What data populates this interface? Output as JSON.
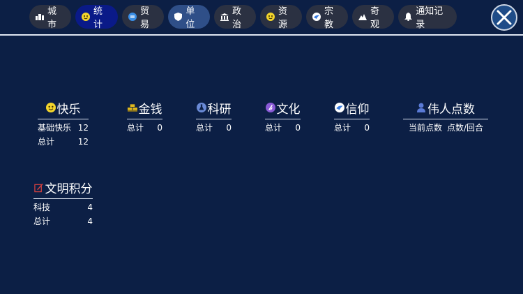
{
  "tabs": [
    {
      "label": "城市",
      "icon": "city-icon"
    },
    {
      "label": "统计",
      "icon": "happy-face-icon"
    },
    {
      "label": "贸易",
      "icon": "trade-icon"
    },
    {
      "label": "单位",
      "icon": "shield-icon"
    },
    {
      "label": "政治",
      "icon": "government-icon"
    },
    {
      "label": "资源",
      "icon": "resource-face-icon"
    },
    {
      "label": "宗教",
      "icon": "religion-dove-icon"
    },
    {
      "label": "奇观",
      "icon": "mountain-icon"
    },
    {
      "label": "通知记录",
      "icon": "bell-icon"
    }
  ],
  "close_icon": "close-x-icon",
  "stats": {
    "happiness": {
      "title": "快乐",
      "icon": "happy-face-icon",
      "rows": [
        {
          "label": "基础快乐",
          "value": "12"
        },
        {
          "label": "总计",
          "value": "12"
        }
      ]
    },
    "gold": {
      "title": "金钱",
      "icon": "gold-bars-icon",
      "rows": [
        {
          "label": "总计",
          "value": "0"
        }
      ]
    },
    "science": {
      "title": "科研",
      "icon": "science-flask-icon",
      "rows": [
        {
          "label": "总计",
          "value": "0"
        }
      ]
    },
    "culture": {
      "title": "文化",
      "icon": "culture-icon",
      "rows": [
        {
          "label": "总计",
          "value": "0"
        }
      ]
    },
    "faith": {
      "title": "信仰",
      "icon": "faith-dove-icon",
      "rows": [
        {
          "label": "总计",
          "value": "0"
        }
      ]
    },
    "great_people": {
      "title": "伟人点数",
      "icon": "person-icon",
      "headers": [
        "当前点数",
        "点数/回合"
      ]
    },
    "civ_points": {
      "title": "文明积分",
      "icon": "civ-points-icon",
      "rows": [
        {
          "label": "科技",
          "value": "4"
        },
        {
          "label": "总计",
          "value": "4"
        }
      ]
    }
  },
  "colors": {
    "background": "#0c1f45",
    "tab": "#2b3142",
    "tab_active": "#0a1a88",
    "tab_selected": "#2f4f88",
    "happy_yellow": "#f3d52c",
    "gold": "#e0b81c",
    "science_blue": "#6a8ad6",
    "culture_purple": "#8a5ad6",
    "faith_blue": "#3a7ce0",
    "person_blue": "#5a7ad6",
    "civ_red": "#d04040"
  }
}
